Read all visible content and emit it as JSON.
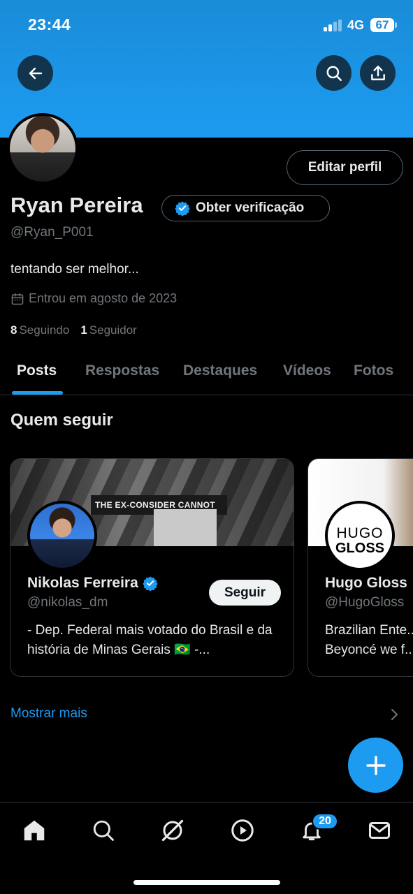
{
  "status_bar": {
    "time": "23:44",
    "network": "4G",
    "battery": "67"
  },
  "colors": {
    "accent": "#1d9bf0",
    "banner": "#1d9bf0",
    "background": "#000000",
    "secondary_text": "#71767b"
  },
  "header": {
    "back_icon": "arrow-left-icon",
    "search_icon": "search-icon",
    "share_icon": "share-icon"
  },
  "profile": {
    "name": "Ryan Pereira",
    "handle": "@Ryan_P001",
    "edit_label": "Editar perfil",
    "verify_label": "Obter verificação",
    "bio": "tentando ser melhor...",
    "joined": "Entrou em agosto de 2023",
    "following_count": "8",
    "following_label": "Seguindo",
    "followers_count": "1",
    "followers_label": "Seguidor"
  },
  "tabs": [
    {
      "label": "Posts",
      "active": true
    },
    {
      "label": "Respostas"
    },
    {
      "label": "Destaques"
    },
    {
      "label": "Vídeos"
    },
    {
      "label": "Fotos"
    }
  ],
  "who_to_follow": {
    "title": "Quem seguir",
    "cards": [
      {
        "name": "Nikolas Ferreira",
        "handle": "@nikolas_dm",
        "description": "- Dep. Federal mais votado do Brasil e da história de Minas Gerais 🇧🇷 -...",
        "follow_label": "Seguir",
        "banner_sign": "THE EX-CONSIDER CANNOT",
        "verified": true
      },
      {
        "name": "Hugo Gloss",
        "handle": "@HugoGloss",
        "description": "Brazilian Ente... Beyoncé we f...",
        "logo_top": "HUGO",
        "logo_bottom": "GLOSS"
      }
    ],
    "show_more": "Mostrar mais"
  },
  "bottom_nav": {
    "items": [
      "home-icon",
      "search-icon",
      "grok-icon",
      "video-icon",
      "bell-icon",
      "mail-icon"
    ],
    "notifications_badge": "20"
  }
}
